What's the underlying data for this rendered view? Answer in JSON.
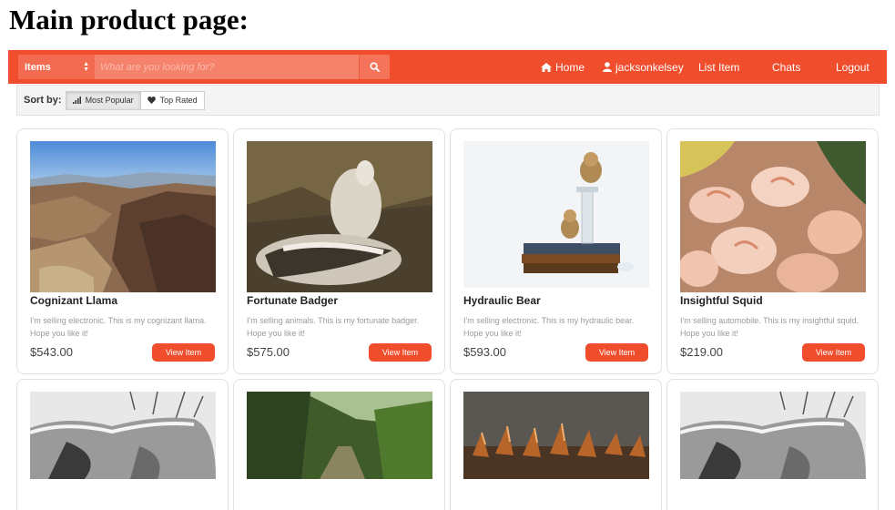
{
  "page": {
    "heading": "Main product page:"
  },
  "navbar": {
    "category": "Items",
    "search_placeholder": "What are you looking for?",
    "links": {
      "home": "Home",
      "user": "jacksonkelsey",
      "list_item": "List Item",
      "chats": "Chats",
      "logout": "Logout"
    },
    "accent_color": "#ef4d2c"
  },
  "sort": {
    "label": "Sort by:",
    "options": [
      {
        "label": "Most Popular",
        "icon": "bar-chart-icon",
        "active": true
      },
      {
        "label": "Top Rated",
        "icon": "heart-icon",
        "active": false
      }
    ]
  },
  "products": [
    {
      "title": "Cognizant Llama",
      "description": "I'm selling electronic. This is my cognizant llama. Hope you like it!",
      "price": "$543.00",
      "button": "View Item",
      "image": "canyon-landscape-photo"
    },
    {
      "title": "Fortunate Badger",
      "description": "I'm selling animals. This is my fortunate badger. Hope you like it!",
      "price": "$575.00",
      "button": "View Item",
      "image": "badger-squirrel-diorama-photo"
    },
    {
      "title": "Hydraulic Bear",
      "description": "I'm selling electronic. This is my hydraulic bear. Hope you like it!",
      "price": "$593.00",
      "button": "View Item",
      "image": "teddy-bears-on-books-photo"
    },
    {
      "title": "Insightful Squid",
      "description": "I'm selling automobile. This is my insightful squid. Hope you like it!",
      "price": "$219.00",
      "button": "View Item",
      "image": "shrimp-dish-photo"
    }
  ],
  "partial_products": [
    {
      "image": "bw-rock-trees-photo"
    },
    {
      "image": "forest-path-photo"
    },
    {
      "image": "spiky-reptile-closeup-photo"
    },
    {
      "image": "bw-rock-trees-photo"
    }
  ]
}
